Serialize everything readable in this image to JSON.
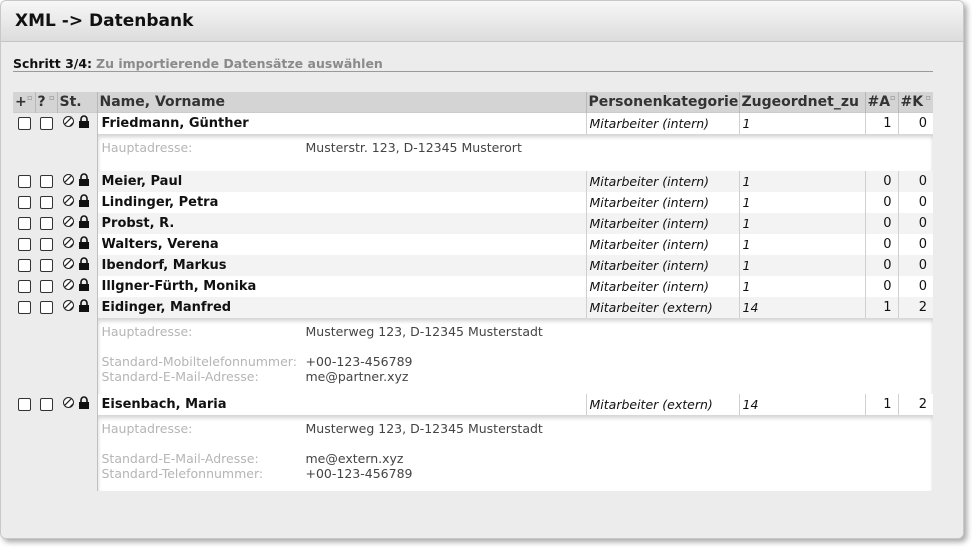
{
  "window": {
    "title": "XML -> Datenbank"
  },
  "step": {
    "label": "Schritt 3/4:",
    "description": "Zu importierende Datensätze auswählen"
  },
  "table": {
    "headers": {
      "add": "+",
      "help": "?",
      "status": "St.",
      "name": "Name, Vorname",
      "category": "Personenkategorie",
      "assigned": "Zugeordnet_zu",
      "a": "#A",
      "k": "#K"
    },
    "rows": [
      {
        "name": "Friedmann, Günther",
        "category": "Mitarbeiter (intern)",
        "assigned": "1",
        "a": "1",
        "k": "0",
        "details": [
          {
            "label": "Hauptadresse:",
            "value": "Musterstr. 123, D-12345 Musterort"
          }
        ]
      },
      {
        "name": "Meier, Paul",
        "category": "Mitarbeiter (intern)",
        "assigned": "1",
        "a": "0",
        "k": "0"
      },
      {
        "name": "Lindinger, Petra",
        "category": "Mitarbeiter (intern)",
        "assigned": "1",
        "a": "0",
        "k": "0"
      },
      {
        "name": "Probst, R.",
        "category": "Mitarbeiter (intern)",
        "assigned": "1",
        "a": "0",
        "k": "0"
      },
      {
        "name": "Walters, Verena",
        "category": "Mitarbeiter (intern)",
        "assigned": "1",
        "a": "0",
        "k": "0"
      },
      {
        "name": "Ibendorf, Markus",
        "category": "Mitarbeiter (intern)",
        "assigned": "1",
        "a": "0",
        "k": "0"
      },
      {
        "name": "Illgner-Fürth, Monika",
        "category": "Mitarbeiter (intern)",
        "assigned": "1",
        "a": "0",
        "k": "0"
      },
      {
        "name": "Eidinger, Manfred",
        "category": "Mitarbeiter (extern)",
        "assigned": "14",
        "a": "1",
        "k": "2",
        "details": [
          {
            "label": "Hauptadresse:",
            "value": "Musterweg 123, D-12345 Musterstadt"
          },
          {
            "label": "Standard-Mobiltelefonnummer:",
            "value": "+00-123-456789"
          },
          {
            "label": "Standard-E-Mail-Adresse:",
            "value": "me@partner.xyz"
          }
        ]
      },
      {
        "name": "Eisenbach, Maria",
        "category": "Mitarbeiter (extern)",
        "assigned": "14",
        "a": "1",
        "k": "2",
        "details": [
          {
            "label": "Hauptadresse:",
            "value": "Musterweg 123, D-12345 Musterstadt"
          },
          {
            "label": "Standard-E-Mail-Adresse:",
            "value": "me@extern.xyz"
          },
          {
            "label": "Standard-Telefonnummer:",
            "value": "+00-123-456789"
          }
        ]
      }
    ]
  },
  "icons": {
    "status": "striped-circle-icon",
    "lock": "lock-icon"
  }
}
